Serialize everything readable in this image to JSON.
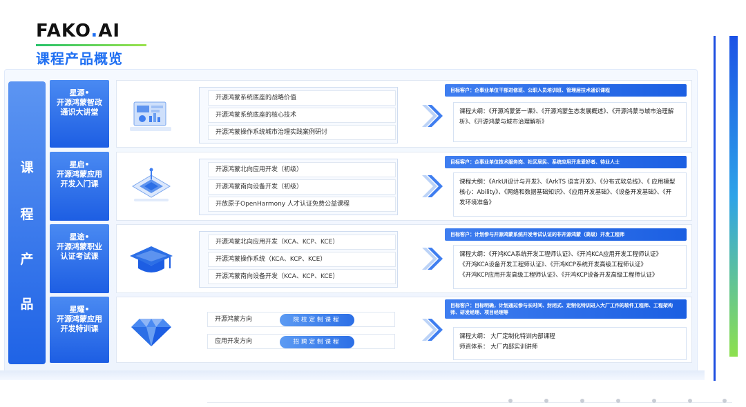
{
  "header": {
    "logo_main": "FAKO",
    "logo_dot": ".",
    "logo_suffix": "AI",
    "title": "课程产品概览"
  },
  "category": {
    "chars": [
      "课",
      "程",
      "产",
      "品"
    ]
  },
  "rows": [
    {
      "title_line1": "星源•",
      "title_line2": "开源鸿蒙智政",
      "title_line3": "通识大讲堂",
      "icon": "dashboard-screen-icon",
      "items": [
        "开源鸿蒙系统底座的战略价值",
        "开源鸿蒙系统底座的核心技术",
        "开源鸿蒙操作系统城市治理实践案例研讨"
      ],
      "target": "目标客户：企事业单位干部进修班、公职人员培训班、管理层技术通识课程",
      "outline": [
        "课程大纲：《开源鸿蒙第一课》、《开源鸿蒙生态发展概述》、《开源鸿蒙与城市治理解",
        "析》、《开源鸿蒙与城市治理解析》"
      ]
    },
    {
      "title_line1": "星启•",
      "title_line2": "开源鸿蒙应用",
      "title_line3": "开发入门课",
      "icon": "chip-circuit-icon",
      "items": [
        "开源鸿蒙北向应用开发（初级）",
        "开源鸿蒙南向设备开发（初级）",
        "开放原子OpenHarmony 人才认证免费公益课程"
      ],
      "target": "目标客户：企事业单位技术服务岗、社区居民、系统应用开发爱好者、待业人士",
      "outline": [
        "课程大纲：《ArkUI设计与开发》、《ArkTS 语言开发》、《分布式软总线》、《 应用模型",
        "核心：Ability》、《网络和数据基础知识》、《应用开发基础》、《设备开发基础》、《开",
        "发环境准备》"
      ]
    },
    {
      "title_line1": "星途•",
      "title_line2": "开源鸿蒙职业",
      "title_line3": "认证考试课",
      "icon": "graduation-cap-icon",
      "items": [
        "开源鸿蒙北向应用开发（KCA、KCP、KCE）",
        "开源鸿蒙操作系统（KCA、KCP、KCE）",
        "开源鸿蒙南向设备开发（KCA、KCP、KCE）"
      ],
      "target": "目标客户：计划参与开源鸿蒙系统开发考试认证的非开源鸿蒙（高级）开发工程师",
      "outline": [
        "课程大纲：《开鸿KCA系统开发工程师认证》、《开鸿KCA应用开发工程师认证》",
        "《开鸿KCA设备开发工程师认证》、《开鸿KCP系统开发高级工程师认证》",
        "《开鸿KCP应用开发高级工程师认证》、《开鸿KCP设备开发高级工程师认证》"
      ]
    },
    {
      "title_line1": "星耀•",
      "title_line2": "开源鸿蒙应用",
      "title_line3": "开发特训课",
      "icon": "diamond-icon",
      "pills": [
        {
          "label": "开源鸿蒙方向",
          "tag": "院校定制课程"
        },
        {
          "label": "应用开发方向",
          "tag": "招聘定制课程"
        }
      ],
      "target": "目标客户：目标明确，计划通过参与长时间、封闭式、定制化特训进入大厂工作的软件工程师、工程架构师、研发经理、项目经理等",
      "outline": [
        "课程大纲：  大厂定制化特训内部课程",
        "师资体系：  大厂内部实训讲师"
      ]
    }
  ],
  "colors": {
    "primary": "#1f6ff2",
    "accent_green": "#27c26a",
    "panel_bg": "#f2f7ff"
  }
}
